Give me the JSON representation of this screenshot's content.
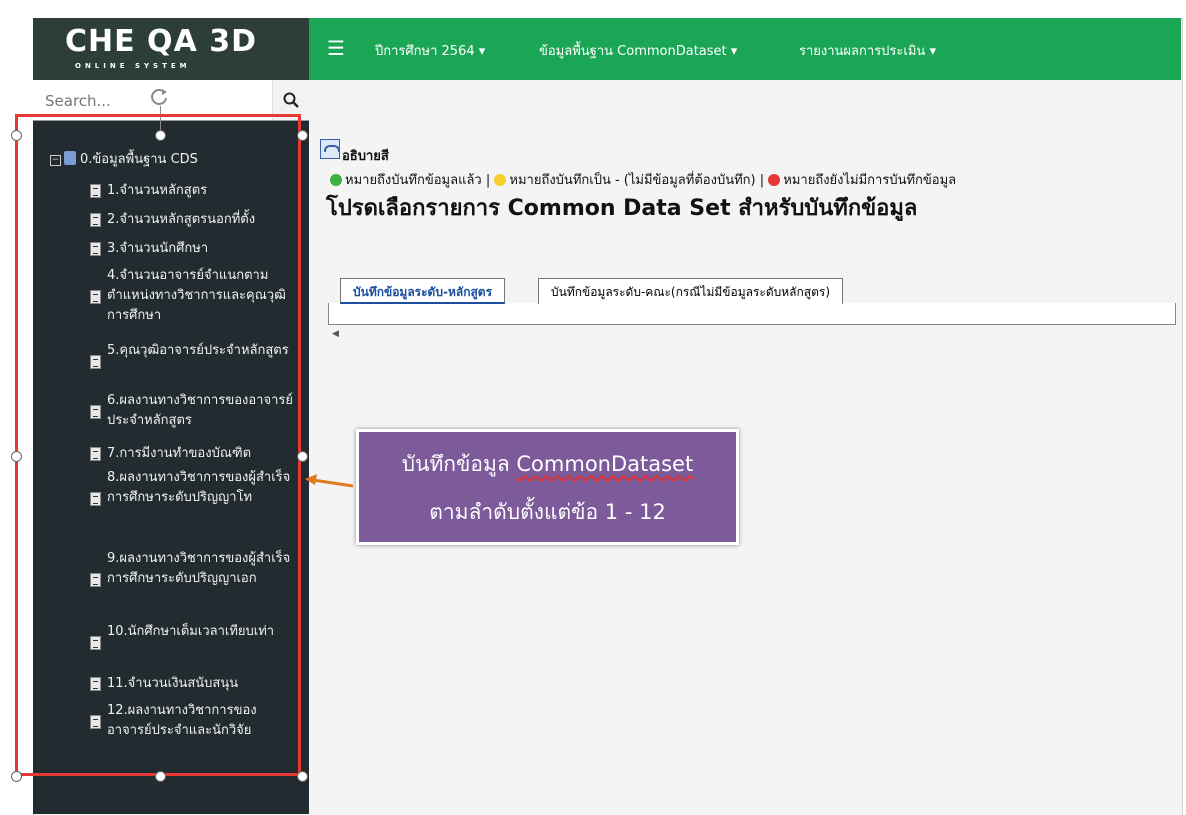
{
  "logo": {
    "main": "CHE QA 3D",
    "sub": "ONLINE SYSTEM"
  },
  "search": {
    "placeholder": "Search...",
    "icon": "search-icon"
  },
  "topbar": {
    "menu_icon": "hamburger-menu-icon",
    "year_menu": "ปีการศึกษา 2564",
    "cds_menu": "ข้อมูลพื้นฐาน CommonDataset",
    "report_menu": "รายงานผลการประเมิน",
    "bg_color": "#1aa655"
  },
  "tree": {
    "root": "0.ข้อมูลพื้นฐาน CDS",
    "items": [
      "1.จำนวนหลักสูตร",
      "2.จำนวนหลักสูตรนอกที่ตั้ง",
      "3.จำนวนนักศึกษา",
      "4.จำนวนอาจารย์จำแนกตามตำแหน่งทางวิชาการและคุณวุฒิการศึกษา",
      "5.คุณวุฒิอาจารย์ประจำหลักสูตร",
      "6.ผลงานทางวิชาการของอาจารย์ประจำหลักสูตร",
      "7.การมีงานทำของบัณฑิต",
      "8.ผลงานทางวิชาการของผู้สำเร็จการศึกษาระดับปริญญาโท",
      "9.ผลงานทางวิชาการของผู้สำเร็จการศึกษาระดับปริญญาเอก",
      "10.นักศึกษาเต็มเวลาเทียบเท่า",
      "11.จำนวนเงินสนับสนุน",
      "12.ผลงานทางวิชาการของอาจารย์ประจำและนักวิจัย"
    ]
  },
  "legend": {
    "title": "อธิบายสี",
    "green": "หมายถึงบันทึกข้อมูลแล้ว",
    "yellow": "หมายถึงบันทึกเป็น - (ไม่มีข้อมูลที่ต้องบันทึก)",
    "red": "หมายถึงยังไม่มีการบันทึกข้อมูล",
    "sep": "|"
  },
  "page_title": "โปรดเลือกรายการ Common Data Set สำหรับบันทึกข้อมูล",
  "tabs": [
    {
      "label": "บันทึกข้อมูลระดับ-หลักสูตร",
      "active": true
    },
    {
      "label": "บันทึกข้อมูลระดับ-คณะ(กรณีไม่มีข้อมูลระดับหลักสูตร)",
      "active": false
    }
  ],
  "callout": {
    "line1_prefix": "บันทึกข้อมูล ",
    "line1_highlight": "CommonDataset",
    "line2": "ตามลำดับตั้งแต่ข้อ 1 - 12",
    "bg_color": "#7d5b9b"
  },
  "colors": {
    "sidebar": "#222b2f",
    "selection": "#e53935",
    "arrow": "#e07a1f"
  }
}
